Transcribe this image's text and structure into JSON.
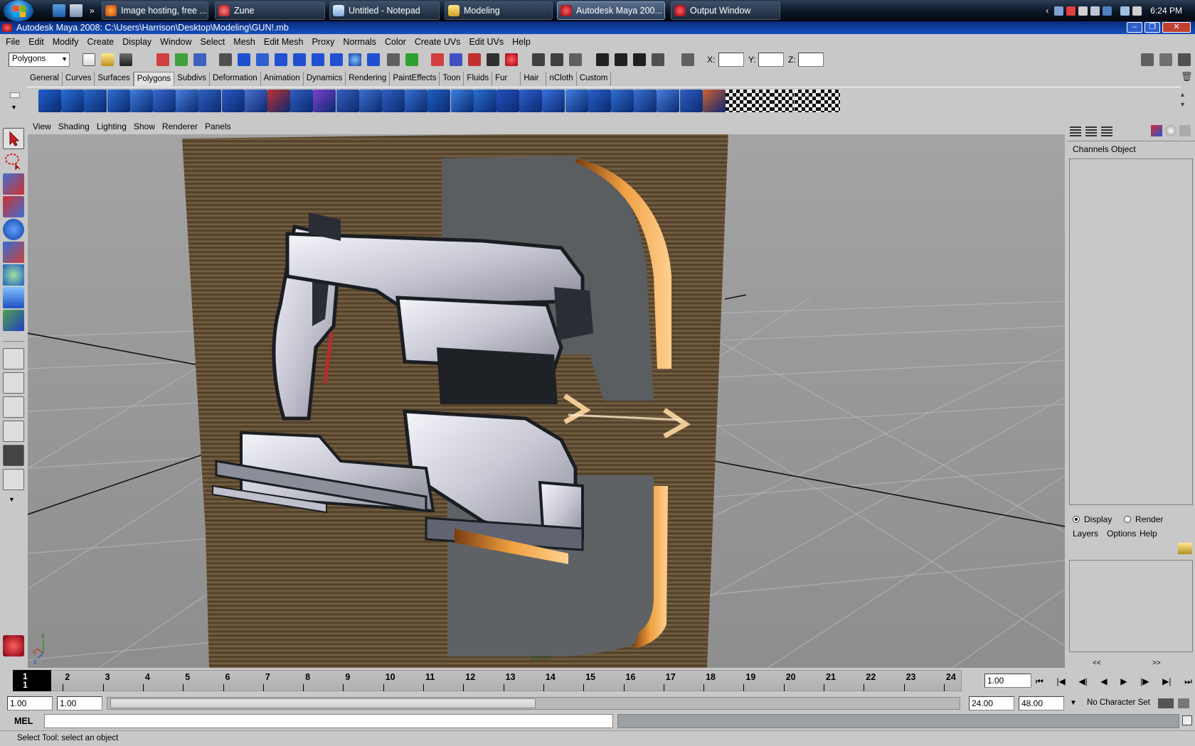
{
  "taskbar": {
    "windows": [
      {
        "label": "Image hosting, free ...",
        "icon": "firefox-icon"
      },
      {
        "label": "Zune",
        "icon": "zune-icon"
      },
      {
        "label": "Untitled - Notepad",
        "icon": "notepad-icon"
      },
      {
        "label": "Modeling",
        "icon": "folder-icon"
      },
      {
        "label": "Autodesk Maya 200...",
        "icon": "maya-icon",
        "active": true
      },
      {
        "label": "Output Window",
        "icon": "maya-icon"
      }
    ],
    "clock": "6:24 PM"
  },
  "titlebar": {
    "title": "Autodesk Maya 2008: C:\\Users\\Harrison\\Desktop\\Modeling\\GUN!.mb"
  },
  "menubar": [
    "File",
    "Edit",
    "Modify",
    "Create",
    "Display",
    "Window",
    "Select",
    "Mesh",
    "Edit Mesh",
    "Proxy",
    "Normals",
    "Color",
    "Create UVs",
    "Edit UVs",
    "Help"
  ],
  "statusline": {
    "menu_set": "Polygons",
    "x_label": "X:",
    "y_label": "Y:",
    "z_label": "Z:"
  },
  "shelf_tabs": [
    "General",
    "Curves",
    "Surfaces",
    "Polygons",
    "Subdivs",
    "Deformation",
    "Animation",
    "Dynamics",
    "Rendering",
    "PaintEffects",
    "Toon",
    "Fluids",
    "Fur",
    "Hair",
    "nCloth",
    "Custom"
  ],
  "active_shelf_tab": "Polygons",
  "viewport": {
    "menu": [
      "View",
      "Shading",
      "Lighting",
      "Show",
      "Renderer",
      "Panels"
    ],
    "camera_label": "persp",
    "axis": {
      "x": "x",
      "y": "y",
      "z": "z"
    }
  },
  "channel_box": {
    "tabs": [
      "Channels",
      "Object"
    ]
  },
  "layer_editor": {
    "radio_display": "Display",
    "radio_render": "Render",
    "menu": [
      "Layers",
      "Options",
      "Help"
    ],
    "scroll_left": "<<",
    "scroll_right": ">>"
  },
  "time_slider": {
    "current_frame": "1",
    "frames": [
      "1",
      "2",
      "3",
      "4",
      "5",
      "6",
      "7",
      "8",
      "9",
      "10",
      "11",
      "12",
      "13",
      "14",
      "15",
      "16",
      "17",
      "18",
      "19",
      "20",
      "21",
      "22",
      "23",
      "24"
    ],
    "current_time_field": "1.00"
  },
  "range_slider": {
    "start_time": "1.00",
    "playback_start": "1.00",
    "playback_end": "24.00",
    "end_time": "48.00",
    "character_set": "No Character Set"
  },
  "command_line": {
    "label": "MEL"
  },
  "help_line": {
    "text": "Select Tool: select an object"
  }
}
